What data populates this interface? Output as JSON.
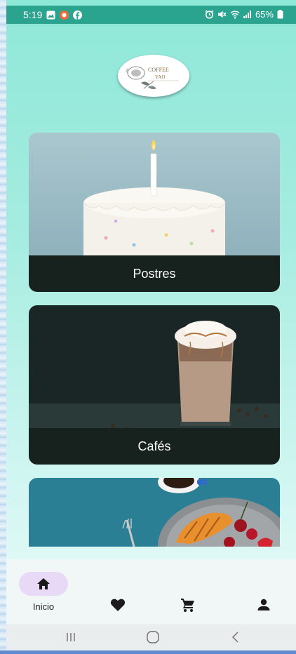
{
  "status_bar": {
    "time": "5:19",
    "battery": "65%"
  },
  "logo": {
    "name": "COFFEE",
    "subname": "YAO"
  },
  "categories": [
    {
      "label": "Postres"
    },
    {
      "label": "Cafés"
    },
    {
      "label": ""
    }
  ],
  "bottom_nav": {
    "items": [
      {
        "label": "Inicio",
        "icon": "home-icon",
        "active": true
      },
      {
        "label": "",
        "icon": "heart-icon",
        "active": false
      },
      {
        "label": "",
        "icon": "cart-icon",
        "active": false
      },
      {
        "label": "",
        "icon": "person-icon",
        "active": false
      }
    ]
  },
  "colors": {
    "background_top": "#8ee8d8",
    "background_bottom": "#eefcfb",
    "status_bar": "#2aa38f",
    "card_label_bar": "#17221f",
    "active_pill": "#e8d9f7"
  }
}
